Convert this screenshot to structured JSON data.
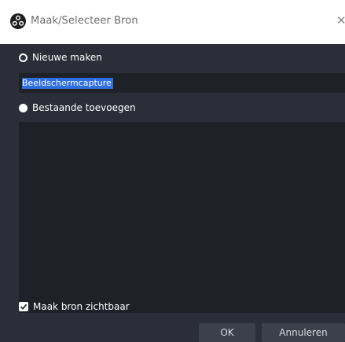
{
  "window": {
    "title": "Maak/Selecteer Bron",
    "app_icon": "obs-logo-icon",
    "close_symbol": "✕"
  },
  "create_new": {
    "label": "Nieuwe maken",
    "selected": true,
    "name_value": "Beeldschermcapture"
  },
  "add_existing": {
    "label": "Bestaande toevoegen",
    "selected": false,
    "items": []
  },
  "make_visible": {
    "label": "Maak bron zichtbaar",
    "checked": true
  },
  "buttons": {
    "ok_label": "OK",
    "cancel_label": "Annuleren"
  },
  "colors": {
    "dialog_background": "#2b2e38",
    "input_background": "#1f2128",
    "selection_highlight": "#2f6ee0",
    "button_background": "#3c404d"
  }
}
